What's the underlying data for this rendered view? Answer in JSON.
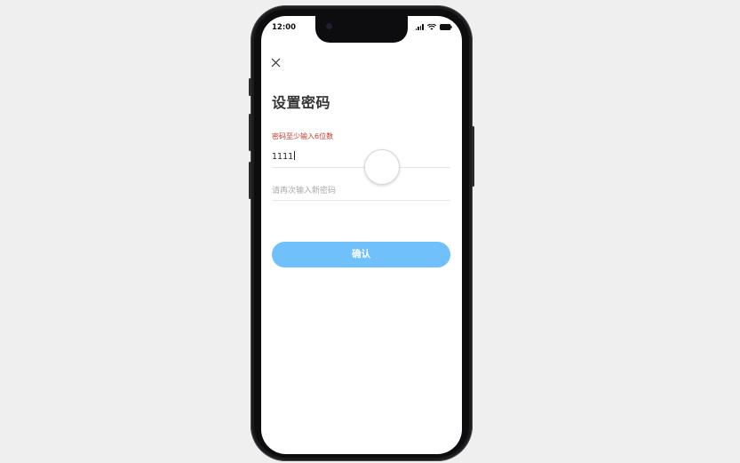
{
  "status_bar": {
    "time": "12:00"
  },
  "page": {
    "title": "设置密码"
  },
  "form": {
    "error_message": "密码至少输入6位数",
    "password_value": "1111",
    "confirm_placeholder": "请再次输入新密码",
    "confirm_button_label": "确认"
  },
  "colors": {
    "accent": "#6fc0fb",
    "error": "#c0392b"
  },
  "icons": {
    "close": "close-icon",
    "signal": "signal-icon",
    "wifi": "wifi-icon",
    "battery": "battery-icon"
  }
}
